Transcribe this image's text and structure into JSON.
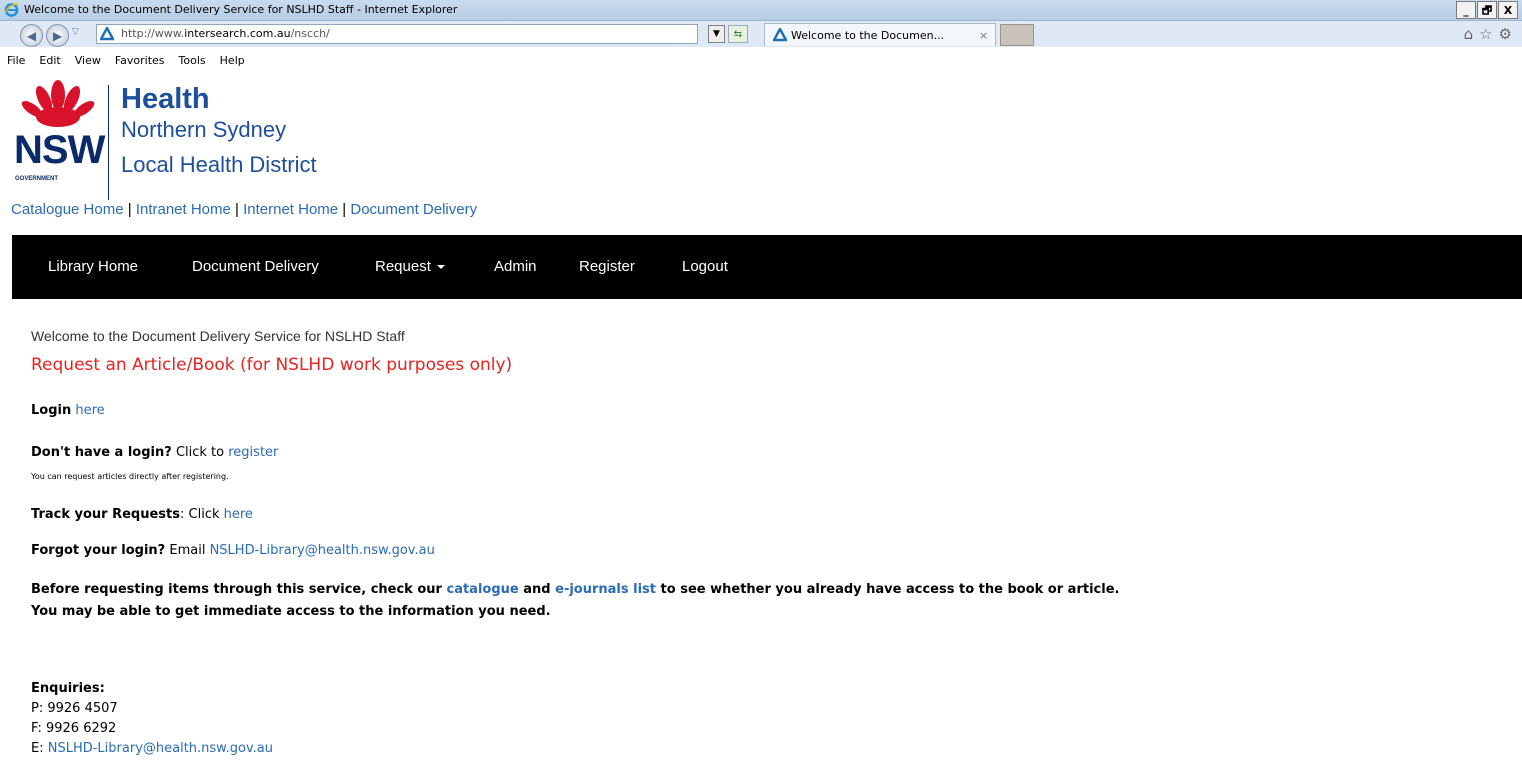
{
  "window": {
    "title": "Welcome to the Document Delivery Service for NSLHD Staff - Internet Explorer",
    "buttons": [
      "_",
      "🗗",
      "X"
    ]
  },
  "browser": {
    "url_prefix": "http://www.",
    "url_domain": "intersearch.com.au",
    "url_path": "/nscch/",
    "tab_title": "Welcome to the Documen...",
    "tab_close": "×"
  },
  "menu": [
    "File",
    "Edit",
    "View",
    "Favorites",
    "Tools",
    "Help"
  ],
  "logo": {
    "nsw": "NSW",
    "government": "GOVERNMENT",
    "health": "Health",
    "district_line1": "Northern Sydney",
    "district_line2": "Local Health District"
  },
  "top_links": [
    "Catalogue Home",
    "Intranet Home",
    "Internet Home",
    "Document Delivery"
  ],
  "nav": [
    "Library Home",
    "Document Delivery",
    "Request",
    "Admin",
    "Register",
    "Logout"
  ],
  "content": {
    "welcome": "Welcome to the Document Delivery Service for NSLHD Staff",
    "heading": "Request an Article/Book (for NSLHD work purposes only)",
    "login_label": "Login",
    "login_link": "here",
    "no_login_label": "Don't have a login?",
    "click_to": "Click to",
    "register_link": "register",
    "register_note": "You can request articles directly after registering.",
    "track_label": "Track your Requests",
    "track_click": ": Click",
    "track_link": "here",
    "forgot_label": "Forgot your login?",
    "forgot_email_text": "Email",
    "library_email": "NSLHD-Library@health.nsw.gov.au",
    "notice_part1": "Before requesting items through this service, check our",
    "catalogue_link": "catalogue",
    "and_text": "and",
    "ejournals_link": "e-journals list",
    "notice_part2": "to see whether you already have access to the book or article.",
    "notice_line2": "You may be able to get immediate access to the information you need."
  },
  "enquiries": {
    "heading": "Enquiries:",
    "phone": "P: 9926 4507",
    "fax": "F: 9926 6292",
    "email_prefix": "E:",
    "email": "NSLHD-Library@health.nsw.gov.au"
  }
}
